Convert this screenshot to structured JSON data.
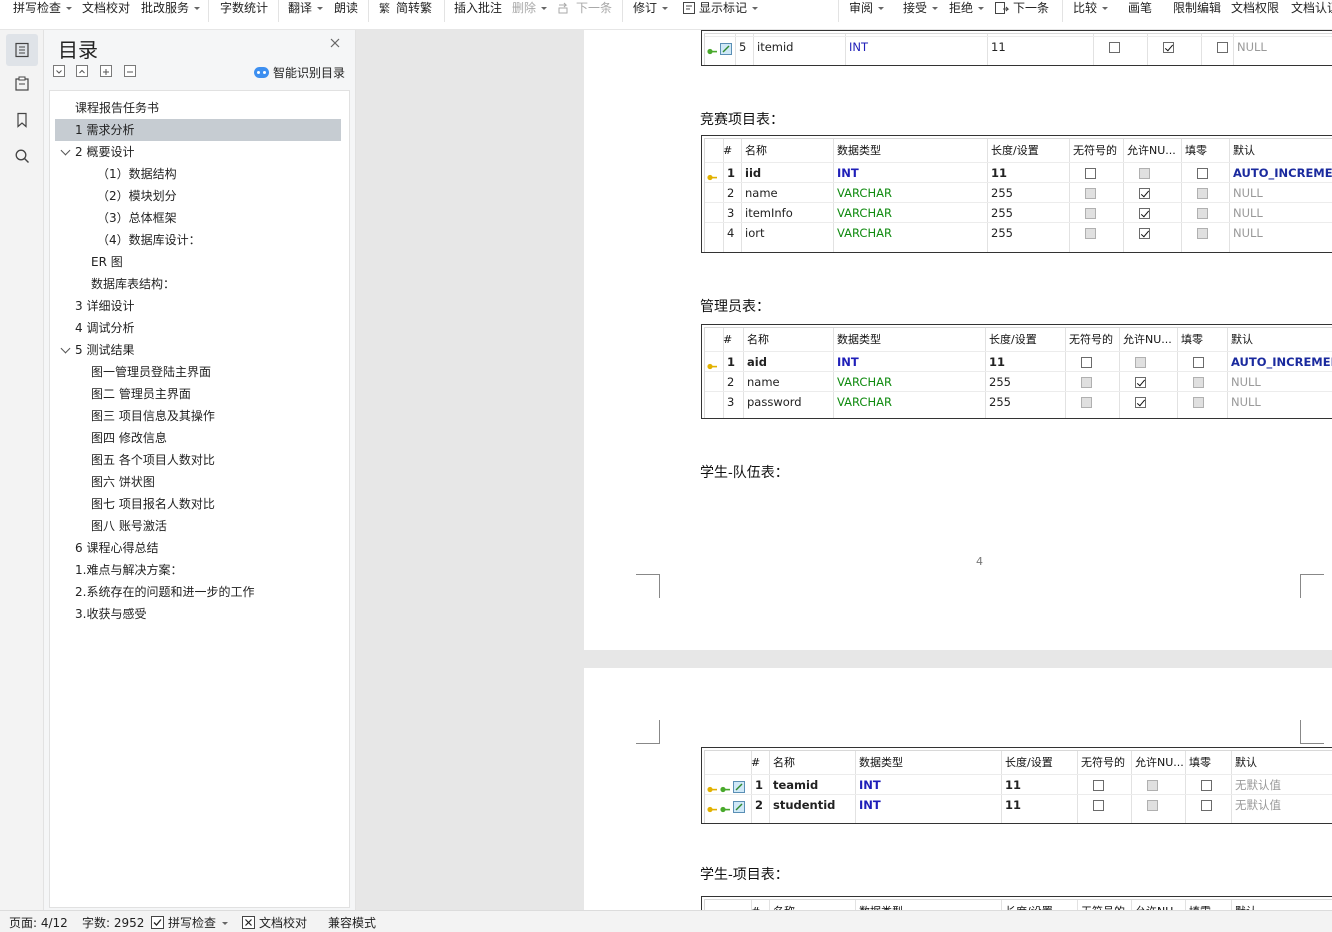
{
  "toolbar": {
    "items": [
      {
        "label": "拼写检查",
        "caret": true,
        "icon": null,
        "disabled": false
      },
      {
        "label": "文档校对",
        "caret": false,
        "icon": null,
        "disabled": false
      },
      {
        "label": "批改服务",
        "caret": true,
        "icon": null,
        "disabled": false
      },
      {
        "label": "字数统计",
        "caret": false,
        "icon": null,
        "disabled": false
      },
      {
        "label": "翻译",
        "caret": true,
        "icon": null,
        "disabled": false
      },
      {
        "label": "朗读",
        "caret": false,
        "icon": null,
        "disabled": false
      },
      {
        "label": "简转繁",
        "caret": false,
        "icon": "convert-icon",
        "disabled": false
      },
      {
        "label": "插入批注",
        "caret": false,
        "icon": null,
        "disabled": false
      },
      {
        "label": "删除",
        "caret": true,
        "icon": null,
        "disabled": true
      },
      {
        "label": "下一条",
        "caret": false,
        "icon": "next-comment-icon",
        "disabled": true
      },
      {
        "label": "修订",
        "caret": true,
        "icon": null,
        "disabled": false
      },
      {
        "label": "显示标记",
        "caret": true,
        "icon": "show-markup-icon",
        "disabled": false
      },
      {
        "label": "审阅",
        "caret": true,
        "icon": null,
        "disabled": false
      },
      {
        "label": "接受",
        "caret": true,
        "icon": null,
        "disabled": false
      },
      {
        "label": "拒绝",
        "caret": true,
        "icon": null,
        "disabled": false
      },
      {
        "label": "下一条",
        "caret": false,
        "icon": "next-change-icon",
        "disabled": false
      },
      {
        "label": "比较",
        "caret": true,
        "icon": null,
        "disabled": false
      },
      {
        "label": "画笔",
        "caret": false,
        "icon": null,
        "disabled": false
      },
      {
        "label": "限制编辑",
        "caret": false,
        "icon": null,
        "disabled": false
      },
      {
        "label": "文档权限",
        "caret": false,
        "icon": null,
        "disabled": false
      },
      {
        "label": "文档认证",
        "caret": false,
        "icon": null,
        "disabled": false
      }
    ]
  },
  "rail": {
    "icons": [
      "toc-icon",
      "clipboard-icon",
      "bookmark-icon",
      "search-icon"
    ]
  },
  "toc": {
    "title": "目录",
    "smart_label": "智能识别目录",
    "items": [
      {
        "text": "课程报告任务书",
        "level": 0,
        "expand": false,
        "selected": false
      },
      {
        "text": "1 需求分析",
        "level": 0,
        "expand": false,
        "selected": true
      },
      {
        "text": "2 概要设计",
        "level": 0,
        "expand": true,
        "selected": false
      },
      {
        "text": "（1）数据结构",
        "level": 2,
        "expand": false,
        "selected": false
      },
      {
        "text": "（2）模块划分",
        "level": 2,
        "expand": false,
        "selected": false
      },
      {
        "text": "（3）总体框架",
        "level": 2,
        "expand": false,
        "selected": false
      },
      {
        "text": "（4）数据库设计：",
        "level": 2,
        "expand": false,
        "selected": false
      },
      {
        "text": "ER 图",
        "level": 1,
        "expand": false,
        "selected": false
      },
      {
        "text": "数据库表结构：",
        "level": 1,
        "expand": false,
        "selected": false
      },
      {
        "text": "3 详细设计",
        "level": 0,
        "expand": false,
        "selected": false
      },
      {
        "text": "4 调试分析",
        "level": 0,
        "expand": false,
        "selected": false
      },
      {
        "text": "5   测试结果",
        "level": 0,
        "expand": true,
        "selected": false
      },
      {
        "text": "图一管理员登陆主界面",
        "level": 1,
        "expand": false,
        "selected": false
      },
      {
        "text": "图二  管理员主界面",
        "level": 1,
        "expand": false,
        "selected": false
      },
      {
        "text": "图三  项目信息及其操作",
        "level": 1,
        "expand": false,
        "selected": false
      },
      {
        "text": "图四  修改信息",
        "level": 1,
        "expand": false,
        "selected": false
      },
      {
        "text": "图五  各个项目人数对比",
        "level": 1,
        "expand": false,
        "selected": false
      },
      {
        "text": "图六  饼状图",
        "level": 1,
        "expand": false,
        "selected": false
      },
      {
        "text": "图七  项目报名人数对比",
        "level": 1,
        "expand": false,
        "selected": false
      },
      {
        "text": "图八  账号激活",
        "level": 1,
        "expand": false,
        "selected": false
      },
      {
        "text": "6 课程心得总结",
        "level": 0,
        "expand": false,
        "selected": false
      },
      {
        "text": "1.难点与解决方案：",
        "level": 0,
        "expand": false,
        "selected": false
      },
      {
        "text": "2.系统存在的问题和进一步的工作",
        "level": 0,
        "expand": false,
        "selected": false
      },
      {
        "text": "3.收获与感受",
        "level": 0,
        "expand": false,
        "selected": false
      }
    ]
  },
  "document": {
    "page_number": "4",
    "headings": {
      "competition": "竞赛项目表：",
      "admin": "管理员表：",
      "student_team": "学生-队伍表：",
      "student_item": "学生-项目表："
    },
    "columns": [
      "#",
      "名称",
      "数据类型",
      "长度/设置",
      "无符号的",
      "允许NU...",
      "填零",
      "默认"
    ],
    "table_prev": {
      "rows": [
        {
          "num": "5",
          "name": "itemid",
          "type": "INT",
          "len": "11",
          "unsigned": false,
          "nullable": true,
          "zerofill": false,
          "default": "NULL",
          "key": false
        }
      ]
    },
    "table_competition": {
      "rows": [
        {
          "num": "1",
          "name": "iid",
          "type": "INT",
          "len": "11",
          "unsigned": false,
          "nullable": false,
          "zerofill": false,
          "default": "AUTO_INCREMENT",
          "key": true
        },
        {
          "num": "2",
          "name": "name",
          "type": "VARCHAR",
          "len": "255",
          "unsigned": false,
          "nullable": true,
          "zerofill": false,
          "default": "NULL",
          "key": false
        },
        {
          "num": "3",
          "name": "itemInfo",
          "type": "VARCHAR",
          "len": "255",
          "unsigned": false,
          "nullable": true,
          "zerofill": false,
          "default": "NULL",
          "key": false
        },
        {
          "num": "4",
          "name": "iort",
          "type": "VARCHAR",
          "len": "255",
          "unsigned": false,
          "nullable": true,
          "zerofill": false,
          "default": "NULL",
          "key": false
        }
      ]
    },
    "table_admin": {
      "rows": [
        {
          "num": "1",
          "name": "aid",
          "type": "INT",
          "len": "11",
          "unsigned": false,
          "nullable": false,
          "zerofill": false,
          "default": "AUTO_INCREMENT",
          "key": true
        },
        {
          "num": "2",
          "name": "name",
          "type": "VARCHAR",
          "len": "255",
          "unsigned": false,
          "nullable": true,
          "zerofill": false,
          "default": "NULL",
          "key": false
        },
        {
          "num": "3",
          "name": "password",
          "type": "VARCHAR",
          "len": "255",
          "unsigned": false,
          "nullable": true,
          "zerofill": false,
          "default": "NULL",
          "key": false
        }
      ]
    },
    "table_student_team": {
      "rows": [
        {
          "num": "1",
          "name": "teamid",
          "type": "INT",
          "len": "11",
          "unsigned": false,
          "nullable": false,
          "zerofill": false,
          "default": "无默认值",
          "key": true
        },
        {
          "num": "2",
          "name": "studentid",
          "type": "INT",
          "len": "11",
          "unsigned": false,
          "nullable": false,
          "zerofill": false,
          "default": "无默认值",
          "key": true
        }
      ]
    }
  },
  "status": {
    "page": "页面: 4/12",
    "words": "字数: 2952",
    "spell": "拼写检查",
    "proofread": "文档校对",
    "compat": "兼容模式"
  }
}
